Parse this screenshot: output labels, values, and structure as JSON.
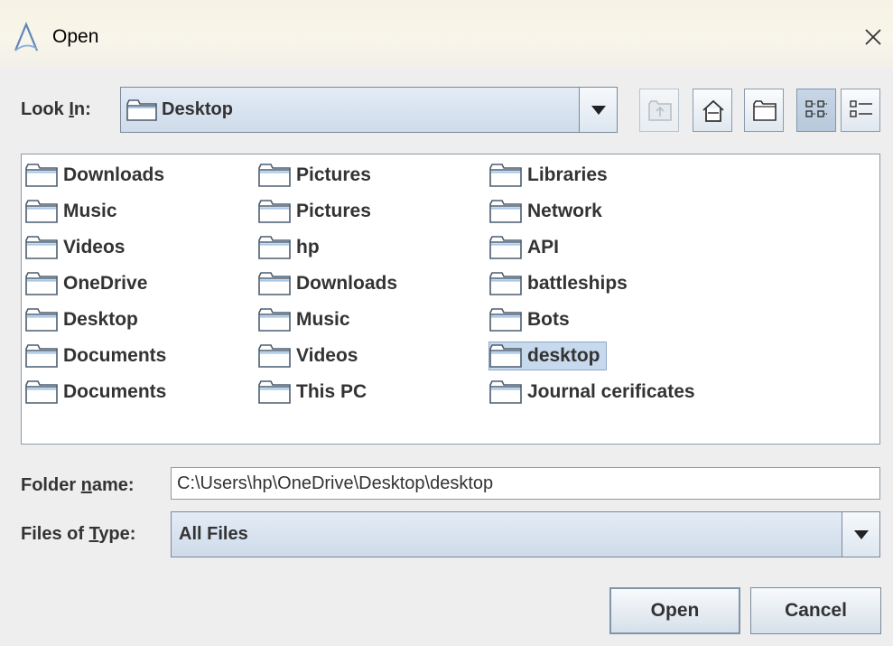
{
  "window": {
    "title": "Open"
  },
  "look_in": {
    "label_prefix": "Look ",
    "label_mnemonic": "I",
    "label_suffix": "n:",
    "value": "Desktop"
  },
  "toolbar": {
    "up_one_level": "up-folder-icon",
    "home": "home-icon",
    "new_folder": "new-folder-icon",
    "list_view": "list-view-icon",
    "details_view": "details-view-icon"
  },
  "files": [
    {
      "name": "Downloads"
    },
    {
      "name": "Music"
    },
    {
      "name": "Videos"
    },
    {
      "name": "OneDrive"
    },
    {
      "name": "Desktop"
    },
    {
      "name": "Documents"
    },
    {
      "name": "Documents"
    },
    {
      "name": "Pictures"
    },
    {
      "name": "Pictures"
    },
    {
      "name": "hp"
    },
    {
      "name": "Downloads"
    },
    {
      "name": "Music"
    },
    {
      "name": "Videos"
    },
    {
      "name": "This PC"
    },
    {
      "name": "Libraries"
    },
    {
      "name": "Network"
    },
    {
      "name": "API"
    },
    {
      "name": "battleships"
    },
    {
      "name": "Bots"
    },
    {
      "name": "desktop",
      "selected": true
    },
    {
      "name": "Journal cerificates"
    }
  ],
  "folder_name": {
    "label_prefix": "Folder ",
    "label_mnemonic": "n",
    "label_suffix": "ame:",
    "value": "C:\\Users\\hp\\OneDrive\\Desktop\\desktop"
  },
  "files_of_type": {
    "label_prefix": "Files of ",
    "label_mnemonic": "T",
    "label_suffix": "ype:",
    "value": "All Files"
  },
  "buttons": {
    "open": "Open",
    "cancel": "Cancel"
  },
  "colors": {
    "selection": "#c7d9ec",
    "border": "#8c9aa8",
    "text": "#333333"
  }
}
